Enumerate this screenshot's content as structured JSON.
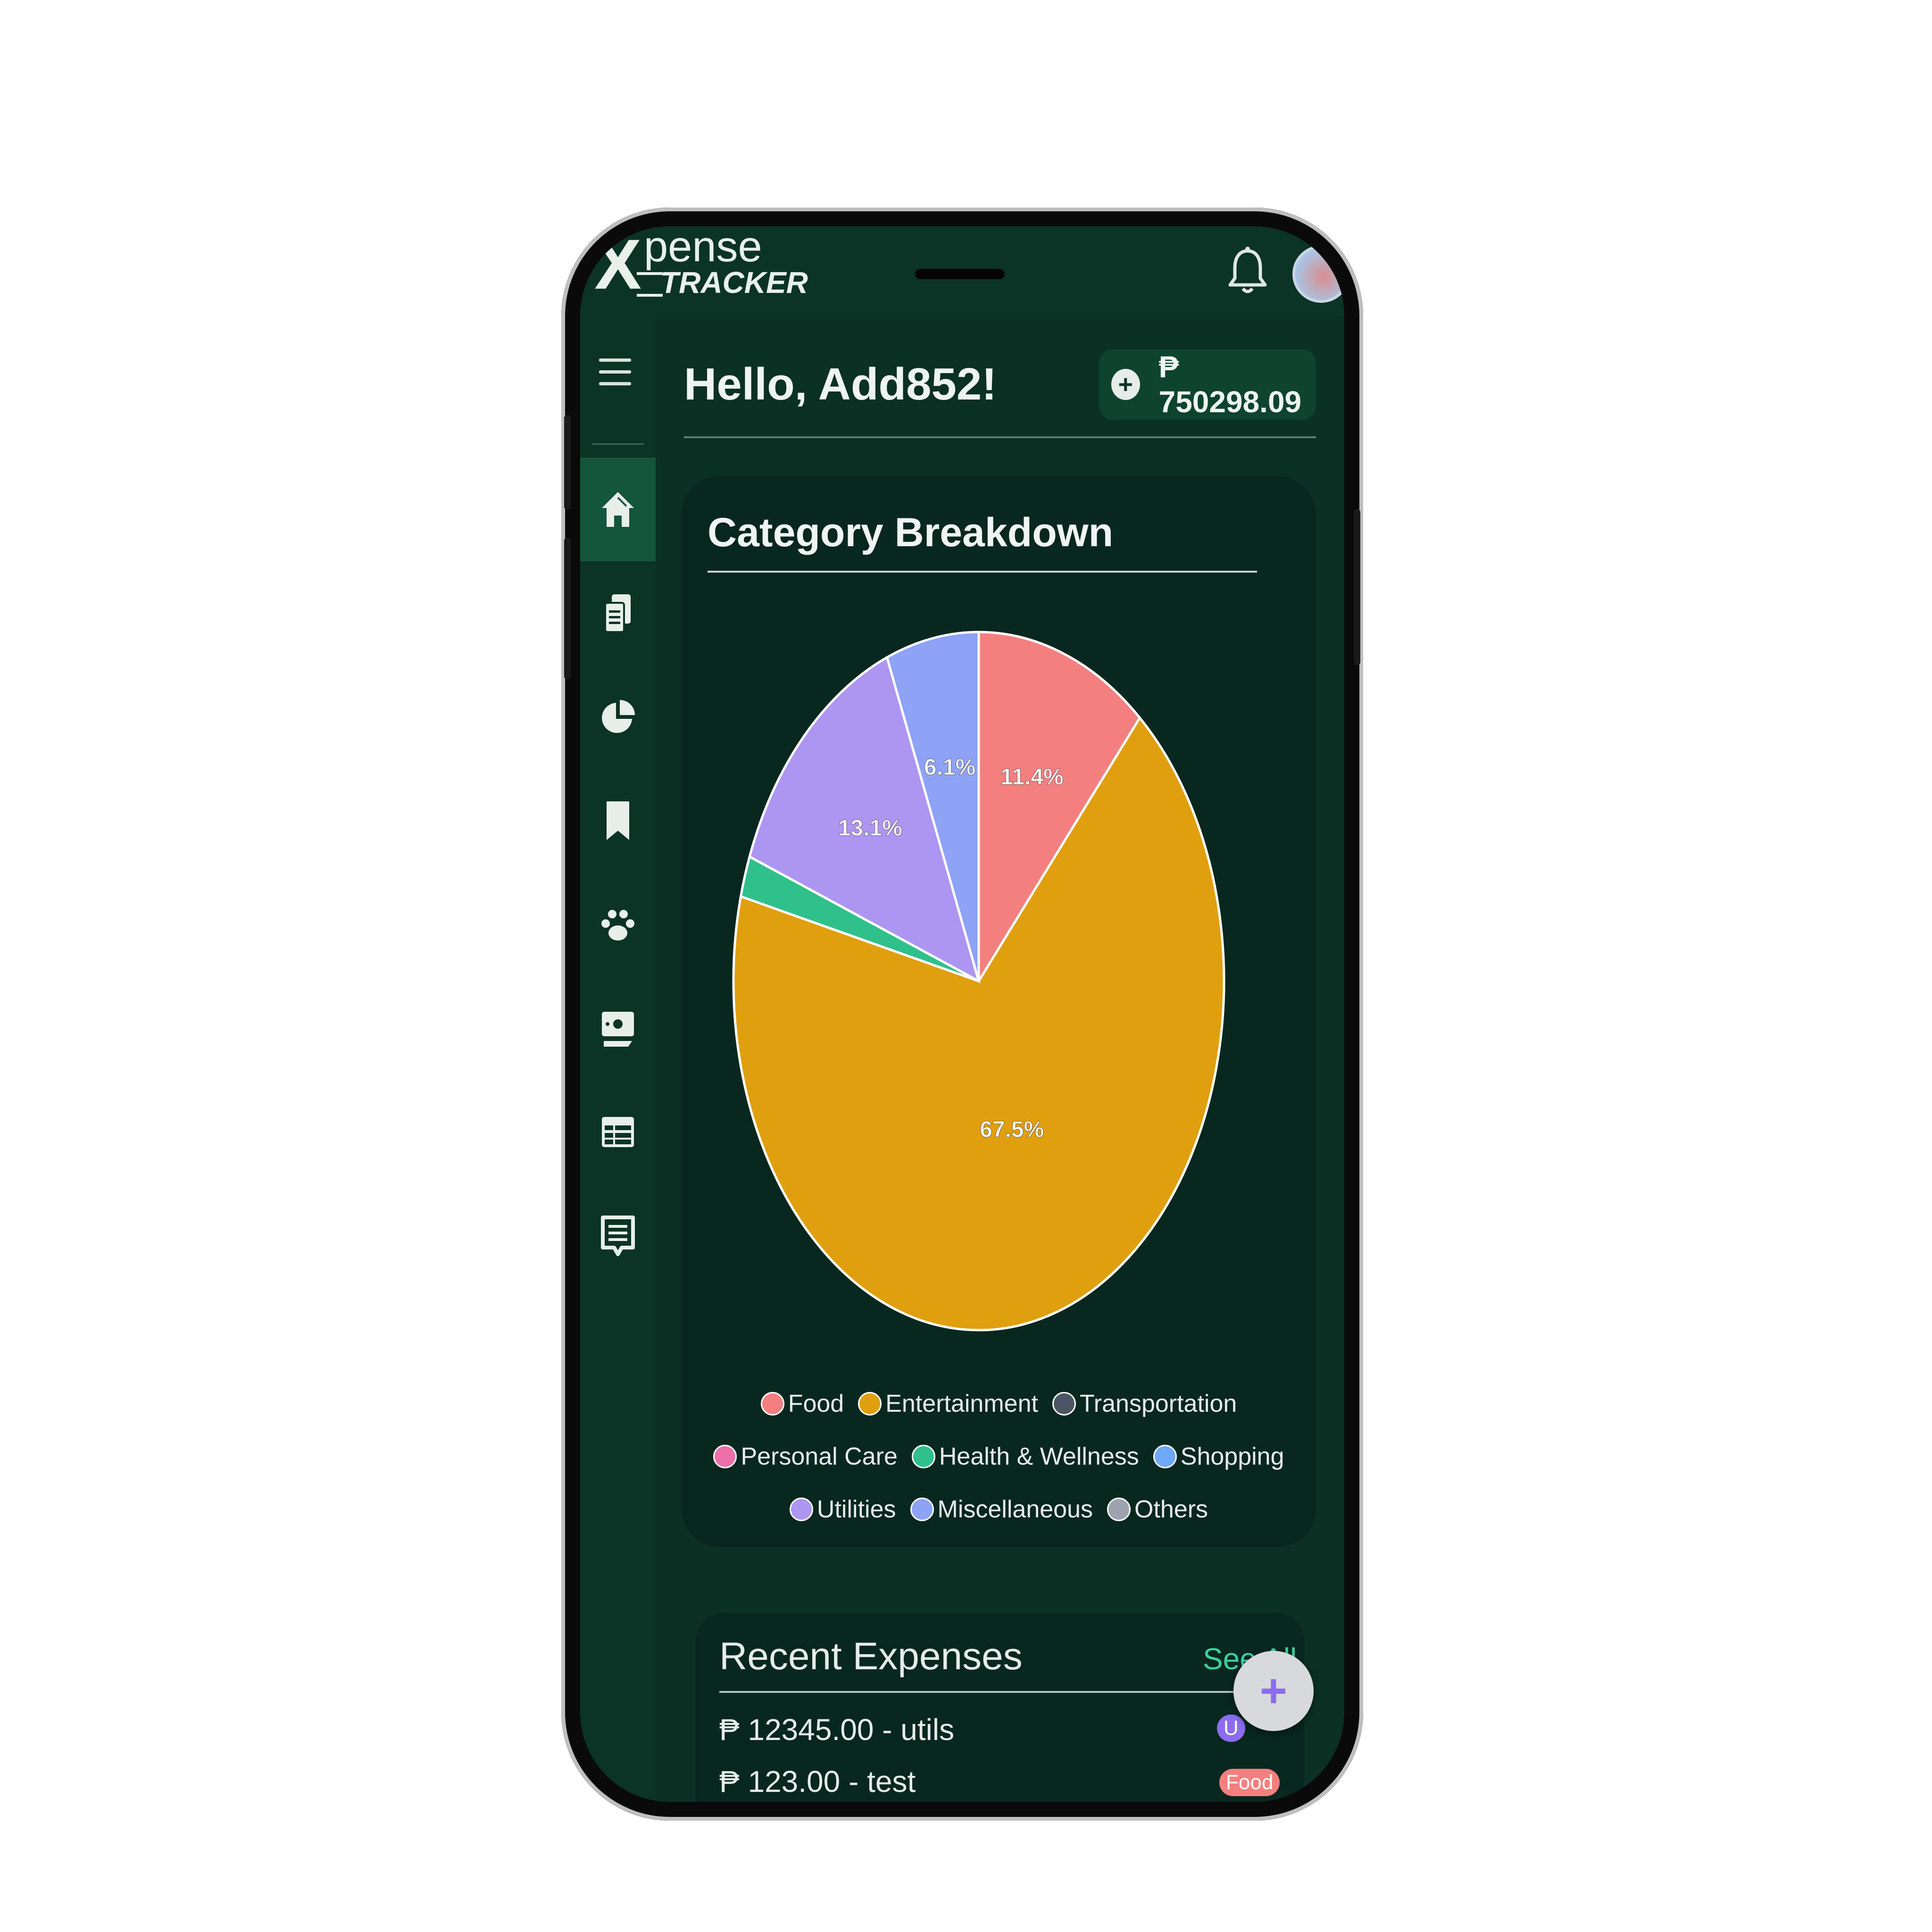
{
  "app": {
    "logo_initial": "X",
    "logo_top": "pense",
    "logo_bottom": "TRACKER"
  },
  "header": {
    "greeting": "Hello, Add852!",
    "balance": "₱ 750298.09",
    "add_symbol": "+"
  },
  "sidebar": {
    "items": [
      {
        "icon": "home-icon",
        "active": true
      },
      {
        "icon": "clipboard-icon",
        "active": false
      },
      {
        "icon": "pie-chart-icon",
        "active": false
      },
      {
        "icon": "bookmark-icon",
        "active": false
      },
      {
        "icon": "paw-icon",
        "active": false
      },
      {
        "icon": "money-icon",
        "active": false
      },
      {
        "icon": "table-icon",
        "active": false
      },
      {
        "icon": "list-icon",
        "active": false
      }
    ]
  },
  "category_card": {
    "title": "Category Breakdown"
  },
  "chart_data": {
    "type": "pie",
    "title": "Category Breakdown",
    "slices": [
      {
        "name": "Food",
        "value": 11.4,
        "label": "11.4%",
        "color": "#f47f7f"
      },
      {
        "name": "Entertainment",
        "value": 67.5,
        "label": "67.5%",
        "color": "#e09f0e"
      },
      {
        "name": "Transportation",
        "value": 0,
        "label": "",
        "color": "#4b5563"
      },
      {
        "name": "Personal Care",
        "value": 0,
        "label": "",
        "color": "#ec6fa8"
      },
      {
        "name": "Health & Wellness",
        "value": 1.9,
        "label": "",
        "color": "#2fc08c"
      },
      {
        "name": "Shopping",
        "value": 0,
        "label": "",
        "color": "#6ea8f7"
      },
      {
        "name": "Utilities",
        "value": 13.1,
        "label": "13.1%",
        "color": "#ad95f2"
      },
      {
        "name": "Miscellaneous",
        "value": 6.1,
        "label": "6.1%",
        "color": "#8ea2f6"
      },
      {
        "name": "Others",
        "value": 0,
        "label": "",
        "color": "#9ca3af"
      }
    ],
    "legend_rows": [
      [
        "Food",
        "Entertainment",
        "Transportation"
      ],
      [
        "Personal Care",
        "Health & Wellness",
        "Shopping"
      ],
      [
        "Utilities",
        "Miscellaneous",
        "Others"
      ]
    ]
  },
  "recent": {
    "title": "Recent Expenses",
    "see_all": "See All",
    "items": [
      {
        "text": "₱ 12345.00 - utils",
        "tag": "U",
        "tag_color": "#8b6cf0"
      },
      {
        "text": "₱ 123.00 - test",
        "tag": "Food",
        "tag_color": "#f47f7f"
      }
    ]
  },
  "fab": {
    "symbol": "+"
  }
}
